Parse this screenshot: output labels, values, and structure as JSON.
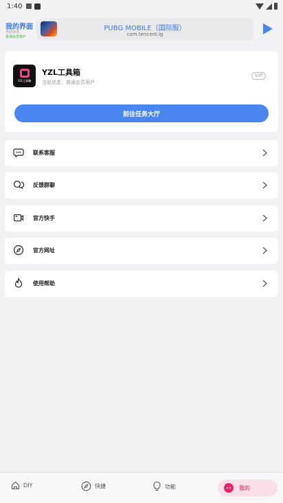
{
  "status_bar": {
    "time": "1:40"
  },
  "header": {
    "page_title": "我的界面",
    "sub_line1": "当前状态",
    "sub_line2": "普通会员用户"
  },
  "game_selector": {
    "name": "PUBG MOBILE（国际服）",
    "package": "com.tencent.ig"
  },
  "profile": {
    "app_name": "YZL工具箱",
    "logo_text": "YZL工具箱",
    "status": "当前状态：普通会员用户",
    "vip_badge": "VIP",
    "task_button": "前往任务大厅"
  },
  "menu": [
    {
      "label": "联系客服",
      "icon": "chat-bubble-icon"
    },
    {
      "label": "反馈群聊",
      "icon": "group-chat-icon"
    },
    {
      "label": "官方快手",
      "icon": "video-camera-icon"
    },
    {
      "label": "官方网址",
      "icon": "compass-icon"
    },
    {
      "label": "使用帮助",
      "icon": "flame-icon"
    }
  ],
  "bottom_nav": {
    "diy": "DIY",
    "shortcut": "快捷",
    "function": "功能",
    "mine": "我的"
  },
  "colors": {
    "accent_blue": "#4a86f0",
    "active_pink": "#e8246a",
    "background": "#f2f2f4"
  }
}
